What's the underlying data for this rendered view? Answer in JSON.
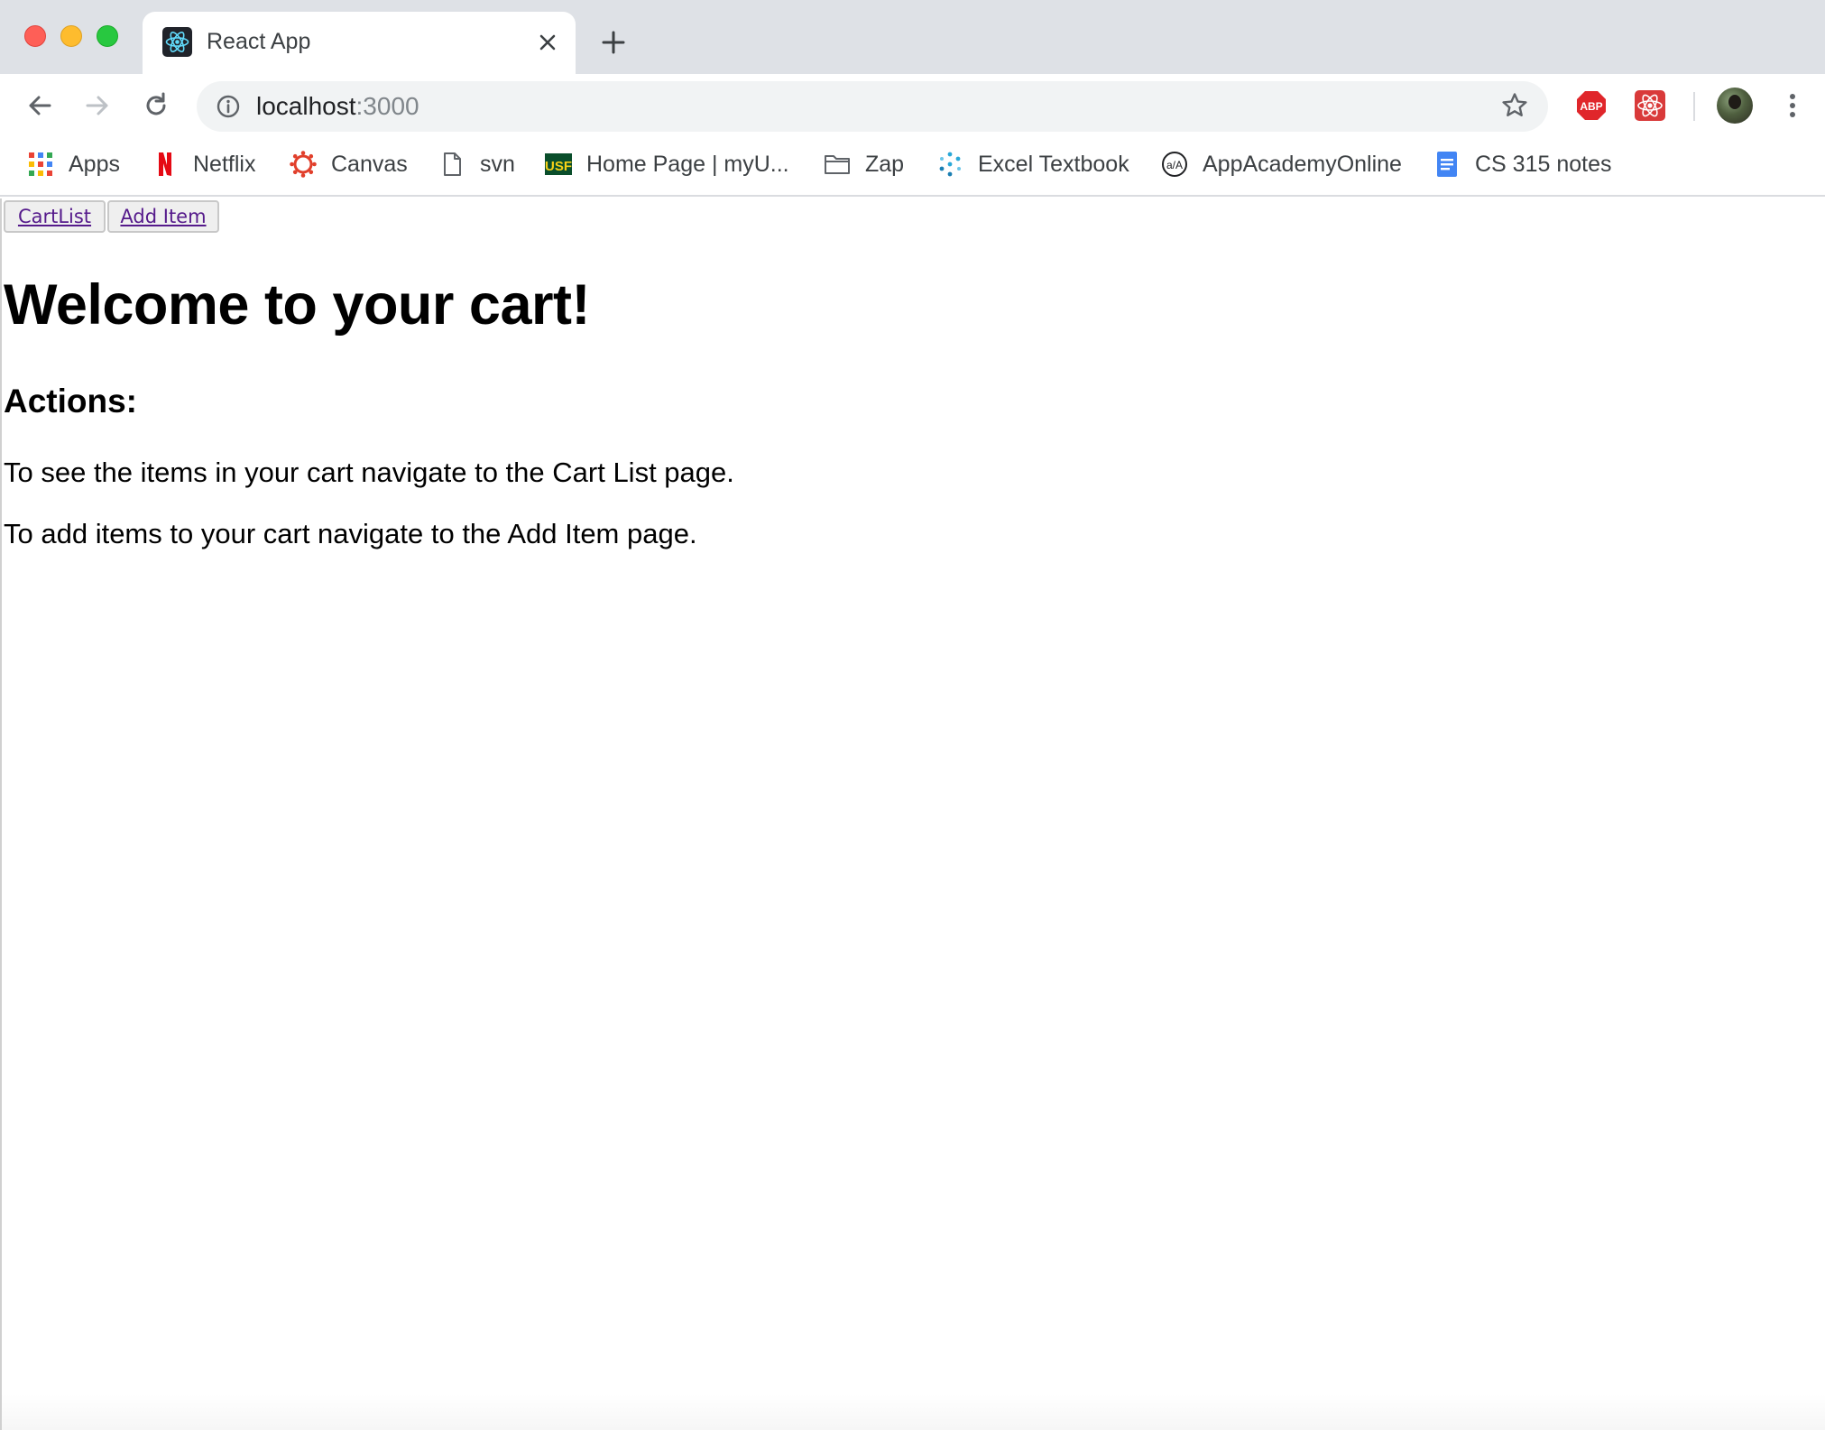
{
  "browser": {
    "tab": {
      "title": "React App"
    },
    "address_bar": {
      "host": "localhost",
      "port": ":3000"
    },
    "bookmarks": [
      {
        "label": "Apps",
        "icon": "apps-grid-icon"
      },
      {
        "label": "Netflix",
        "icon": "netflix-icon"
      },
      {
        "label": "Canvas",
        "icon": "canvas-icon"
      },
      {
        "label": "svn",
        "icon": "file-icon"
      },
      {
        "label": "Home Page | myU...",
        "icon": "usf-icon"
      },
      {
        "label": "Zap",
        "icon": "folder-icon"
      },
      {
        "label": "Excel Textbook",
        "icon": "excel-textbook-icon"
      },
      {
        "label": "AppAcademyOnline",
        "icon": "appacademy-icon"
      },
      {
        "label": "CS 315 notes",
        "icon": "docs-icon"
      }
    ],
    "extensions": [
      {
        "label": "ABP",
        "icon": "adblock-plus-icon"
      },
      {
        "label": "",
        "icon": "react-devtools-icon"
      }
    ]
  },
  "page": {
    "nav": {
      "cartlist_label": "CartList",
      "add_item_label": "Add Item"
    },
    "heading": "Welcome to your cart!",
    "subheading": "Actions:",
    "paragraphs": [
      "To see the items in your cart navigate to the Cart List page.",
      "To add items to your cart navigate to the Add Item page."
    ]
  },
  "colors": {
    "tab_strip": "#dee1e6",
    "link_visited": "#551a8b",
    "abp_red": "#e0262b"
  }
}
